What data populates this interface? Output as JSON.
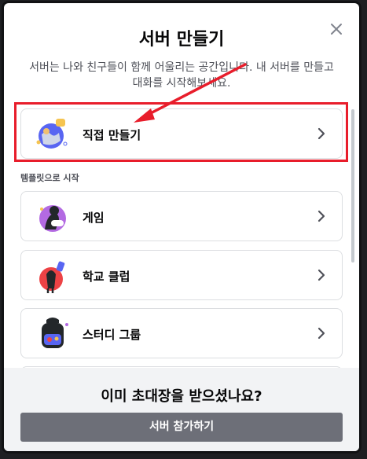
{
  "modal": {
    "title": "서버 만들기",
    "subtitle": "서버는 나와 친구들이 함께 어울리는 공간입니다. 내 서버를 만들고 대화를 시작해보세요."
  },
  "create_option": {
    "label": "직접 만들기",
    "icon": "globe-icon"
  },
  "templates": {
    "section_label": "템플릿으로 시작",
    "items": [
      {
        "label": "게임",
        "icon": "game-icon"
      },
      {
        "label": "학교 클럽",
        "icon": "school-club-icon"
      },
      {
        "label": "스터디 그룹",
        "icon": "backpack-icon"
      }
    ]
  },
  "footer": {
    "title": "이미 초대장을 받으셨나요?",
    "join_button": "서버 참가하기"
  },
  "annotation": {
    "highlight_color": "#e81d2b",
    "arrow_color": "#e81d2b"
  }
}
